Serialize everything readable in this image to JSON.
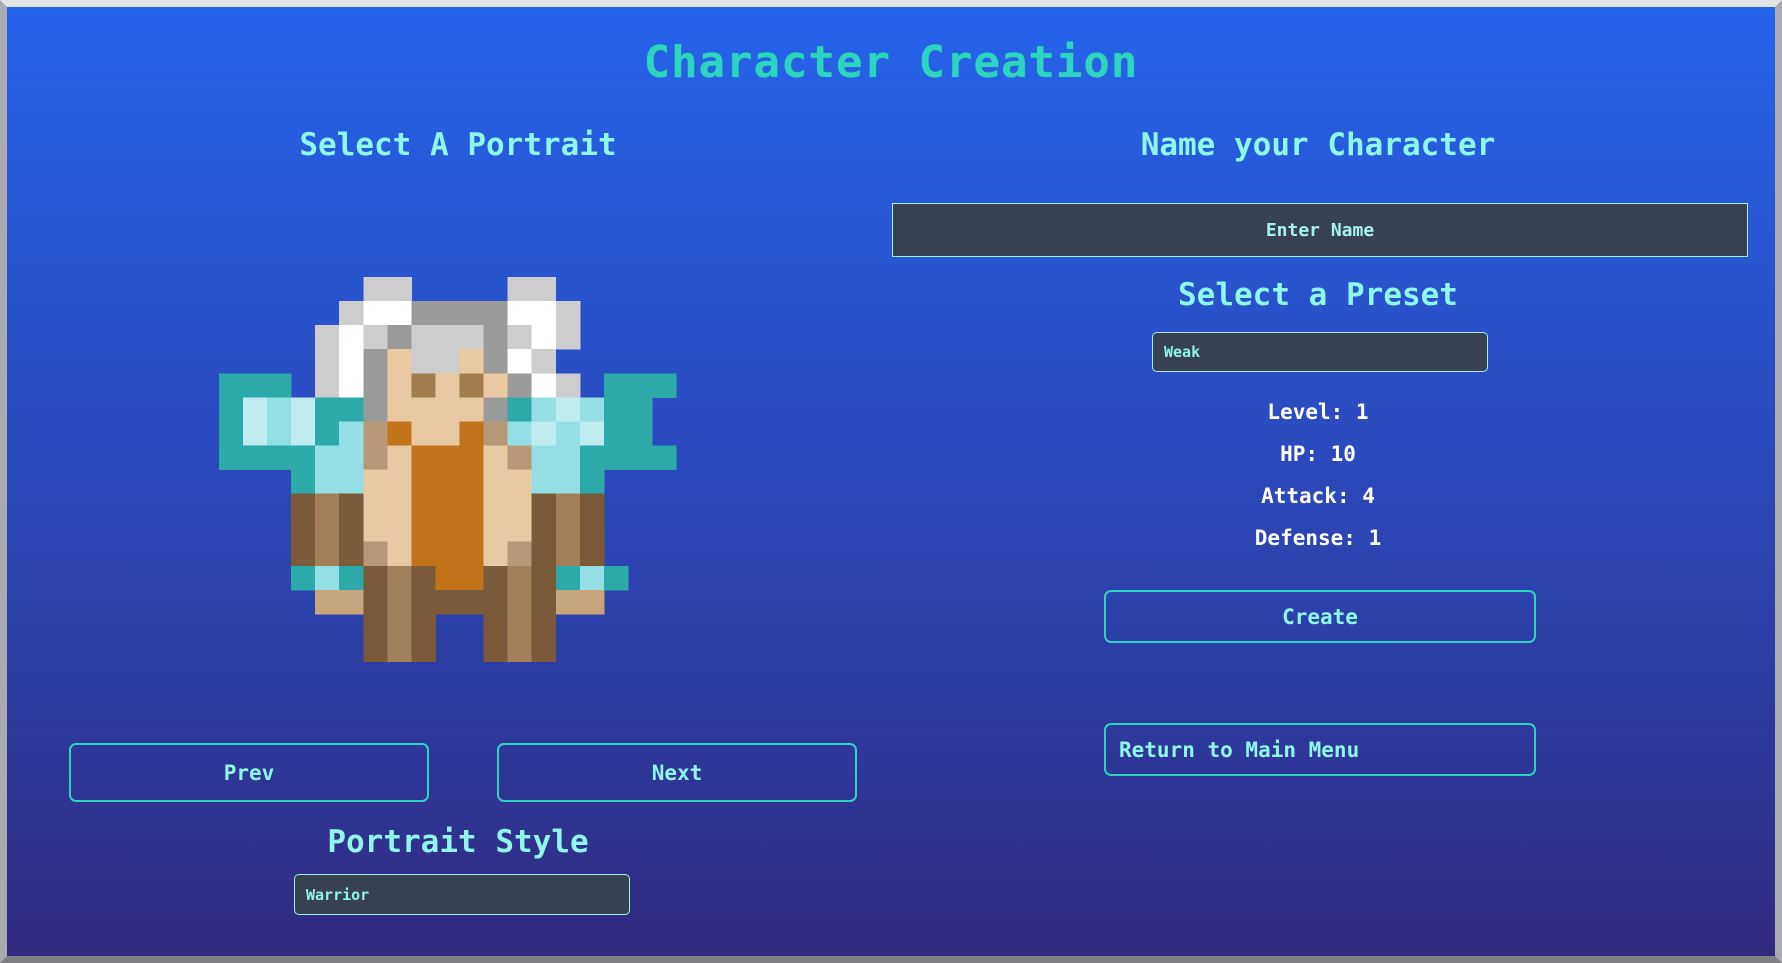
{
  "title": "Character Creation",
  "portrait_panel": {
    "heading": "Select A Portrait",
    "prev_label": "Prev",
    "next_label": "Next",
    "style_heading": "Portrait Style",
    "style_selected": "Warrior"
  },
  "character_panel": {
    "name_heading": "Name your Character",
    "name_placeholder": "Enter Name",
    "name_value": "",
    "preset_heading": "Select a Preset",
    "preset_selected": "Weak",
    "stats": {
      "level": "Level: 1",
      "hp": "HP: 10",
      "attack": "Attack: 4",
      "defense": "Defense: 1"
    },
    "create_label": "Create",
    "return_label": "Return to Main Menu"
  },
  "portrait_sprite": {
    "icon": "dwarf-warrior-portrait",
    "palette": {
      "A": "#cdcdcd",
      "W": "#ffffff",
      "G": "#9a9a9a",
      "S": "#e9c9a1",
      "E": "#a27c4a",
      "T": "#2ea9a9",
      "L": "#bfecef",
      "C": "#94dfe3",
      "O": "#c0731a",
      "D": "#7a5a38",
      "M": "#a3805a",
      "K": "#b89877",
      "N": "#c7a57c"
    },
    "rows": [
      "......AA....AA......",
      ".....AWWGGGGWWA.....",
      "....AWAGAAAGAWA.....",
      "....AWGSAASGWA......",
      "TTT.AWGSESESGWA.TTT.",
      "TLCLTTGSSSSGTCLCTT..",
      "TLCLTCKOSSOKCLCLTT..",
      "TTTTCCKSOOOSKCCTTTT.",
      "...TCCSSOOOSSCCT....",
      "...DMDSSOOOSSDMD....",
      "...DMDSSOOOSSDMD....",
      "...DMDKSOOOSKDMD....",
      "...TCTDMDOODMDTCT...",
      "....NNDMDDDDMDNN....",
      "......DMD..DMD......",
      "......DMD..DMD......"
    ]
  }
}
